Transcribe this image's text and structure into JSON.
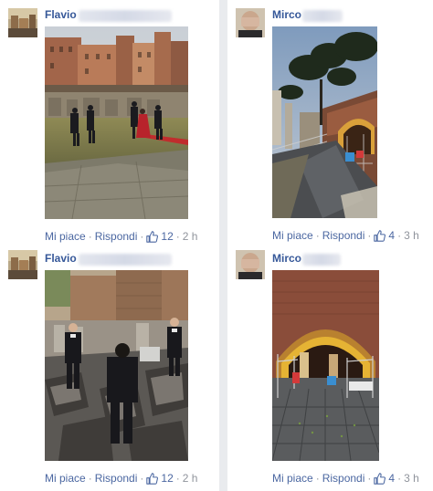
{
  "comments": [
    {
      "author": "Flavio",
      "like_label": "Mi piace",
      "reply_label": "Rispondi",
      "likes": "12",
      "time": "2 h"
    },
    {
      "author": "Mirco",
      "like_label": "Mi piace",
      "reply_label": "Rispondi",
      "likes": "4",
      "time": "3 h"
    },
    {
      "author": "Flavio",
      "like_label": "Mi piace",
      "reply_label": "Rispondi",
      "likes": "12",
      "time": "2 h"
    },
    {
      "author": "Mirco",
      "like_label": "Mi piace",
      "reply_label": "Rispondi",
      "likes": "4",
      "time": "3 h"
    }
  ],
  "separator": "·",
  "icons": {
    "like": "thumbs-up-icon"
  },
  "colors": {
    "link": "#365899",
    "action": "#4b67a1",
    "meta": "#90949c",
    "background": "#e9ebee"
  }
}
